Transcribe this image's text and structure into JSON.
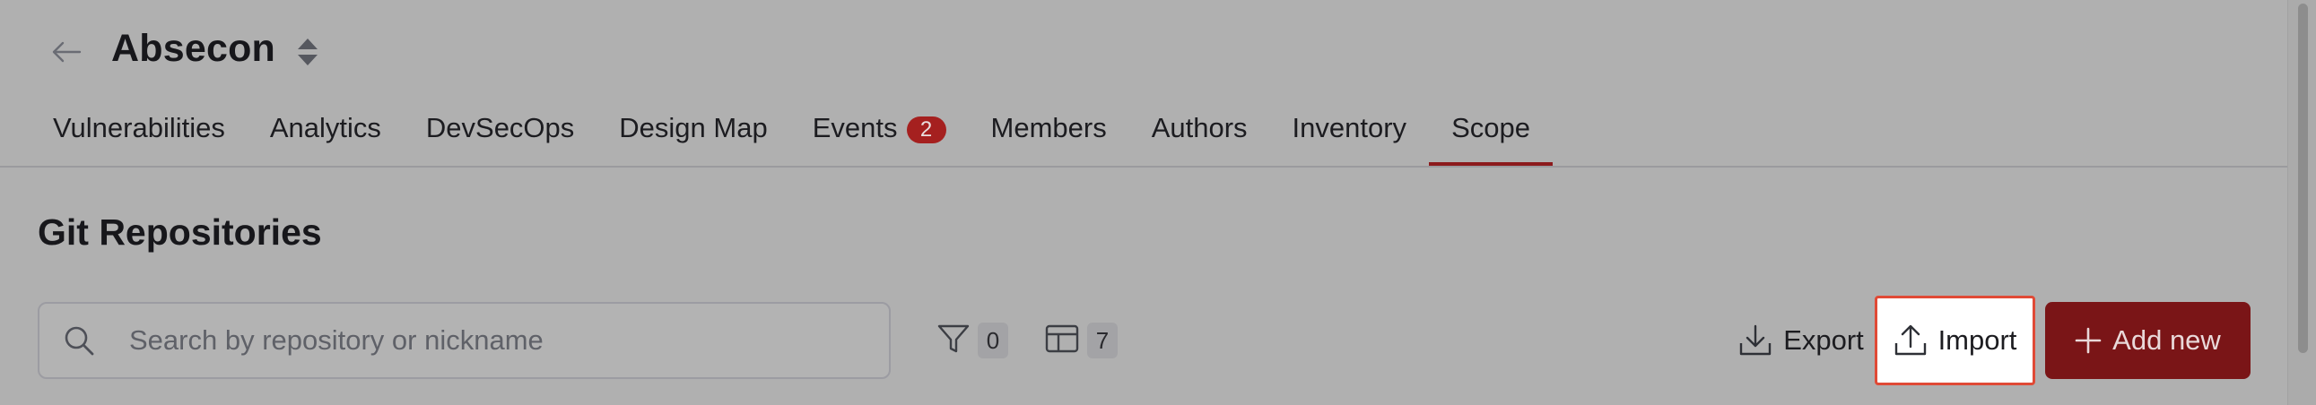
{
  "header": {
    "back_icon": "arrow-left-icon",
    "project_name": "Absecon",
    "sort_icon": "sort-up-down-icon"
  },
  "tabs": [
    {
      "label": "Vulnerabilities",
      "active": false
    },
    {
      "label": "Analytics",
      "active": false
    },
    {
      "label": "DevSecOps",
      "active": false
    },
    {
      "label": "Design Map",
      "active": false
    },
    {
      "label": "Events",
      "badge": "2",
      "active": false
    },
    {
      "label": "Members",
      "active": false
    },
    {
      "label": "Authors",
      "active": false
    },
    {
      "label": "Inventory",
      "active": false
    },
    {
      "label": "Scope",
      "active": true
    }
  ],
  "section": {
    "title": "Git Repositories"
  },
  "search": {
    "placeholder": "Search by repository or nickname",
    "value": ""
  },
  "filters": {
    "filter_count": "0",
    "columns_count": "7"
  },
  "actions": {
    "export_label": "Export",
    "import_label": "Import",
    "add_label": "Add new"
  },
  "colors": {
    "accent": "#8c1a1c",
    "add_button": "#7a1517",
    "badge": "#a5201f",
    "highlight_border": "#e04a36"
  }
}
